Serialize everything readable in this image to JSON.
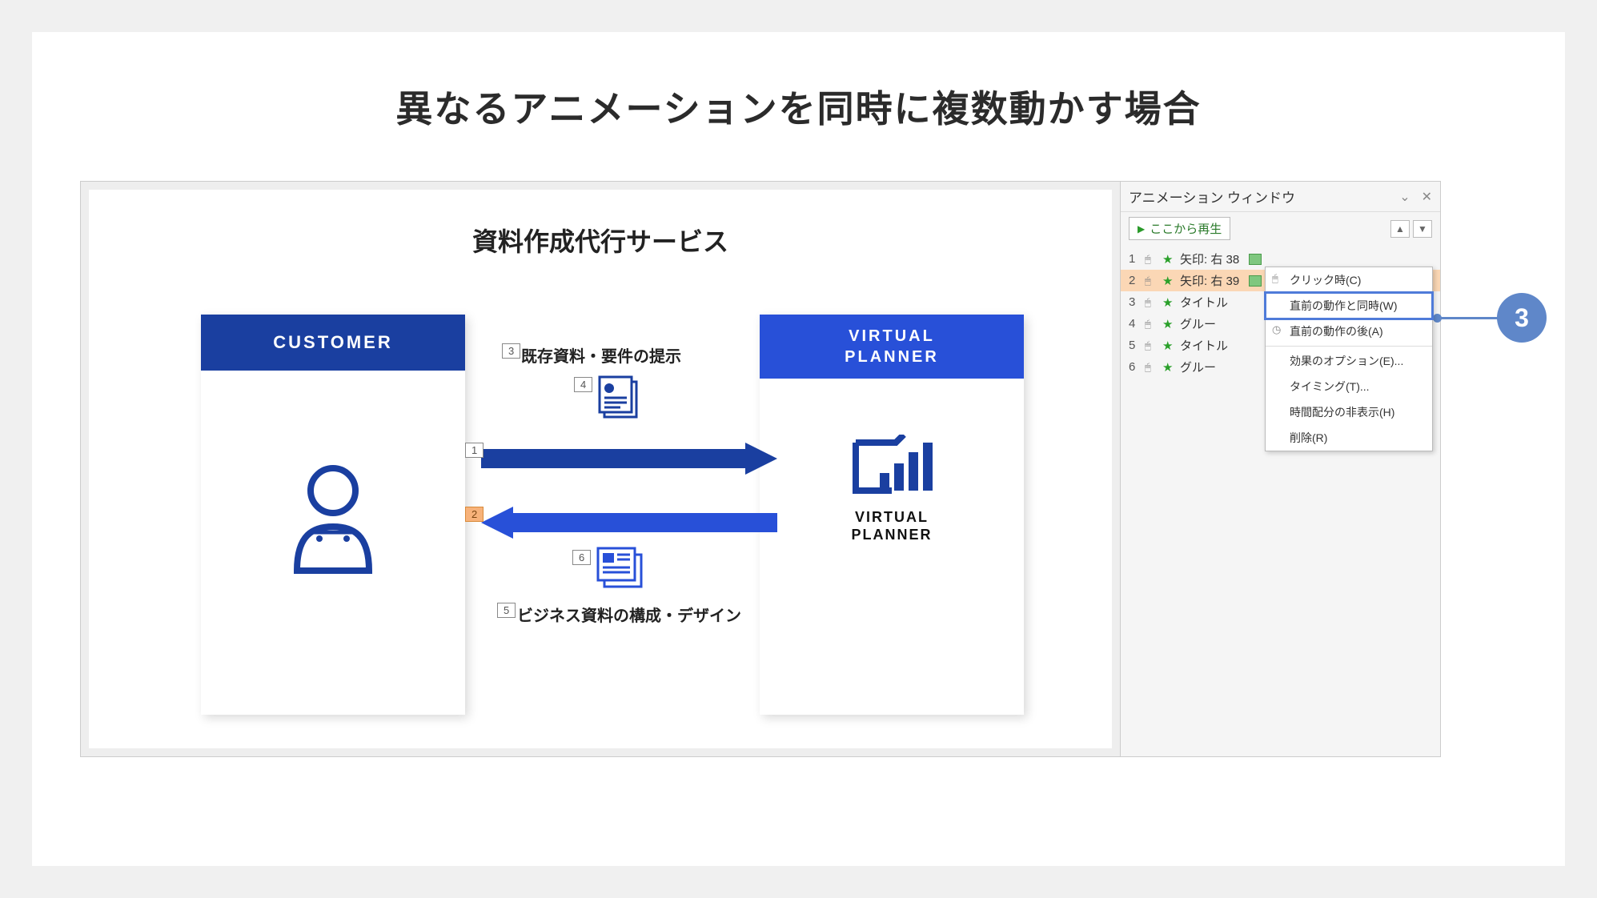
{
  "title": "異なるアニメーションを同時に複数動かす場合",
  "slide": {
    "title": "資料作成代行サービス",
    "customer_label": "CUSTOMER",
    "planner_label_line1": "VIRTUAL",
    "planner_label_line2": "PLANNER",
    "planner_logo_line1": "VIRTUAL",
    "planner_logo_line2": "PLANNER",
    "top_caption": "既存資料・要件の提示",
    "bottom_caption": "ビジネス資料の構成・デザイン",
    "tags": {
      "t1": "1",
      "t2": "2",
      "t3": "3",
      "t4": "4",
      "t5": "5",
      "t6": "6"
    }
  },
  "anim_pane": {
    "title": "アニメーション ウィンドウ",
    "play_label": "ここから再生",
    "items": [
      {
        "num": "1",
        "label": "矢印: 右 38"
      },
      {
        "num": "2",
        "label": "矢印: 右 39"
      },
      {
        "num": "3",
        "label": "タイトル"
      },
      {
        "num": "4",
        "label": "グルー"
      },
      {
        "num": "5",
        "label": "タイトル"
      },
      {
        "num": "6",
        "label": "グルー"
      }
    ]
  },
  "ctx": {
    "click": "クリック時(C)",
    "with_prev": "直前の動作と同時(W)",
    "after_prev": "直前の動作の後(A)",
    "effect_opts": "効果のオプション(E)...",
    "timing": "タイミング(T)...",
    "hide_timeline": "時間配分の非表示(H)",
    "remove": "削除(R)"
  },
  "callout": "3"
}
